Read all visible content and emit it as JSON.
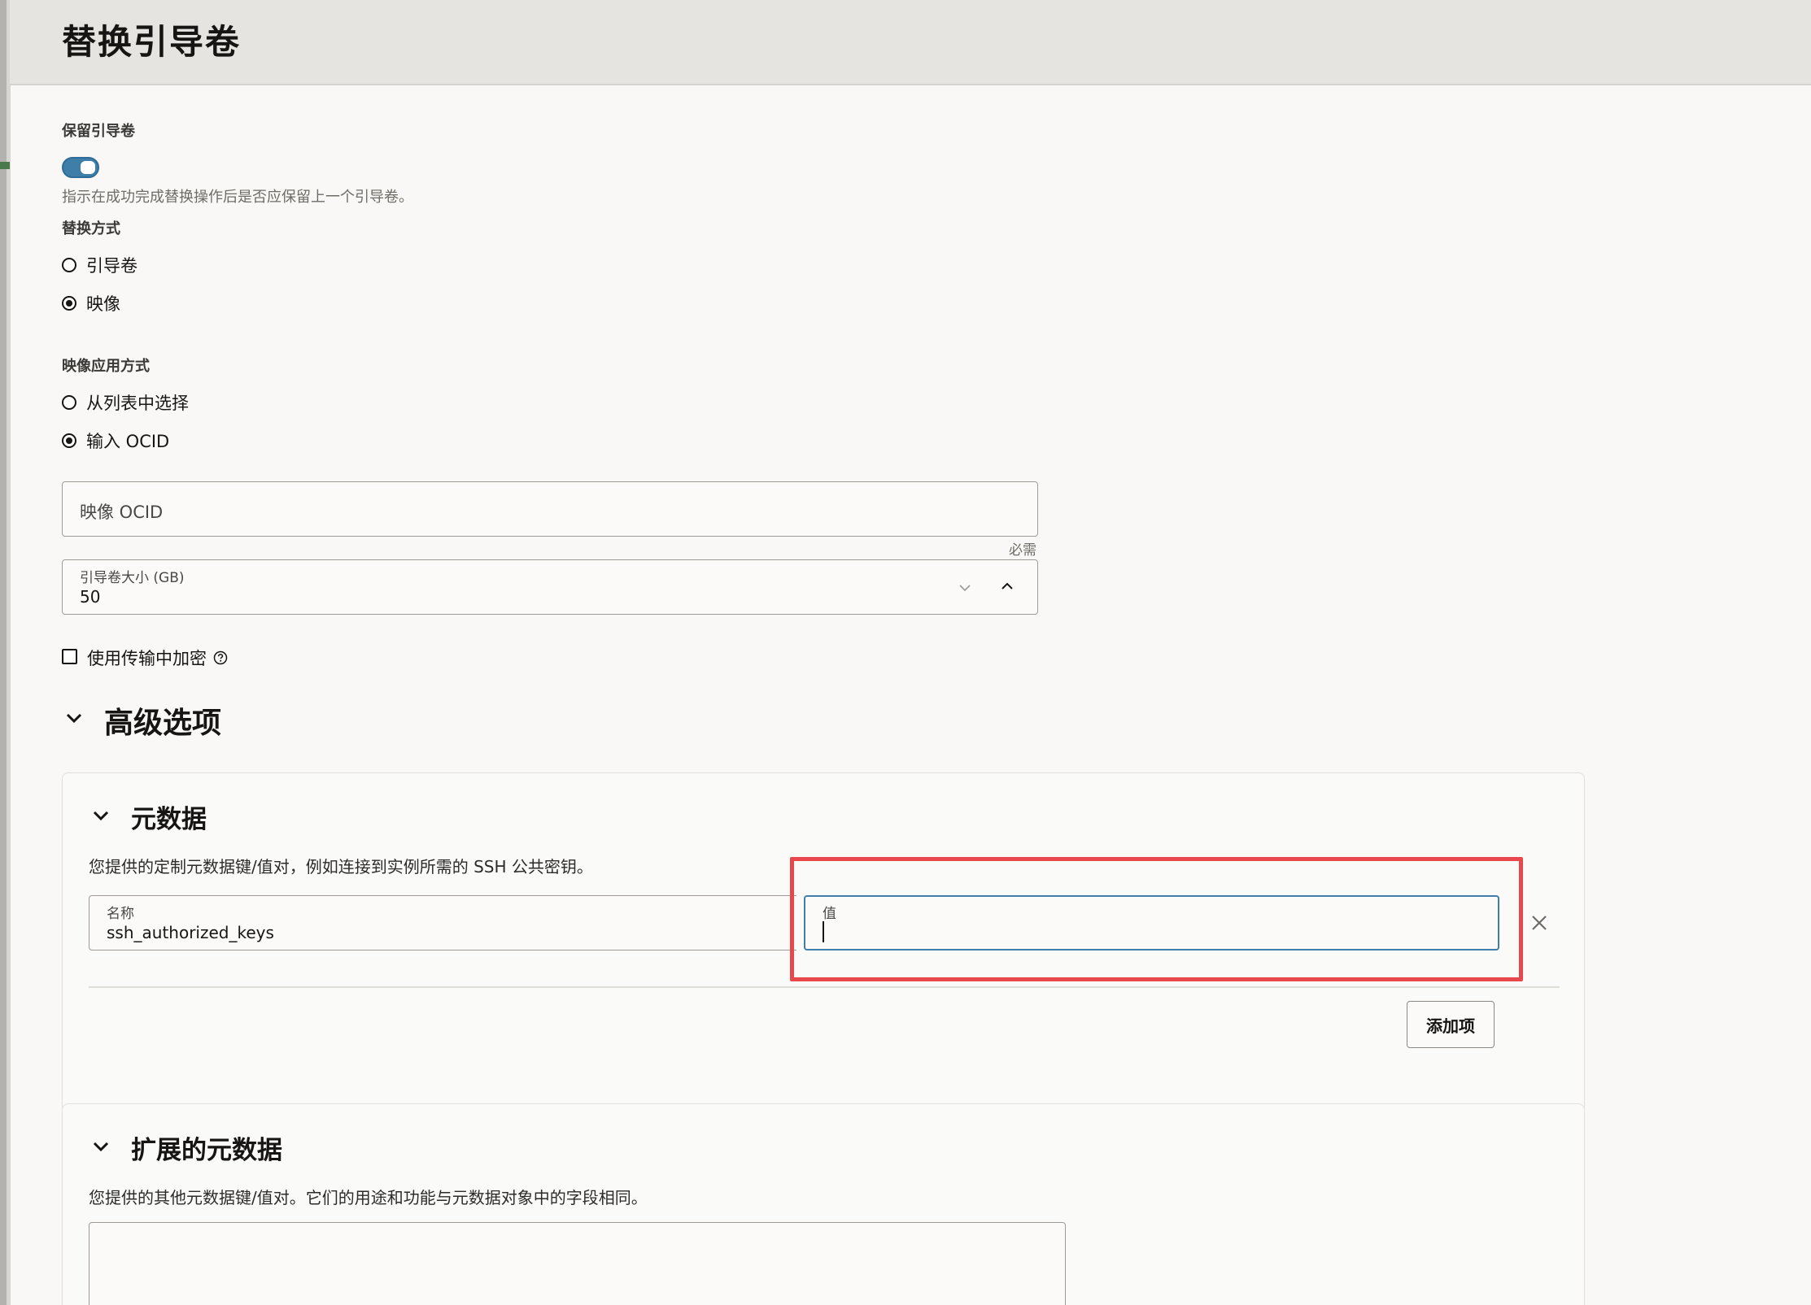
{
  "header": {
    "title": "替换引导卷"
  },
  "preserve_boot_volume": {
    "label": "保留引导卷",
    "enabled": true,
    "help": "指示在成功完成替换操作后是否应保留上一个引导卷。"
  },
  "replace_by": {
    "label": "替换方式",
    "options": [
      "引导卷",
      "映像"
    ],
    "selected": "映像"
  },
  "image_source": {
    "label": "映像应用方式",
    "options": [
      "从列表中选择",
      "输入 OCID"
    ],
    "selected": "输入 OCID"
  },
  "image_ocid": {
    "placeholder": "映像 OCID",
    "required_text": "必需"
  },
  "boot_volume_size": {
    "label": "引导卷大小 (GB)",
    "value": "50"
  },
  "in_transit_encryption": {
    "label": "使用传输中加密",
    "checked": false
  },
  "advanced": {
    "title": "高级选项",
    "metadata": {
      "title": "元数据",
      "description": "您提供的定制元数据键/值对，例如连接到实例所需的 SSH 公共密钥。",
      "name_label": "名称",
      "name_value": "ssh_authorized_keys",
      "value_label": "值",
      "value_value": "",
      "add_button": "添加项"
    },
    "extended_metadata": {
      "title": "扩展的元数据",
      "description": "您提供的其他元数据键/值对。它们的用途和功能与元数据对象中的字段相同。"
    }
  },
  "colors": {
    "accent": "#3e7ea8",
    "highlight": "#e8484c",
    "focus": "#3e7ea8"
  }
}
